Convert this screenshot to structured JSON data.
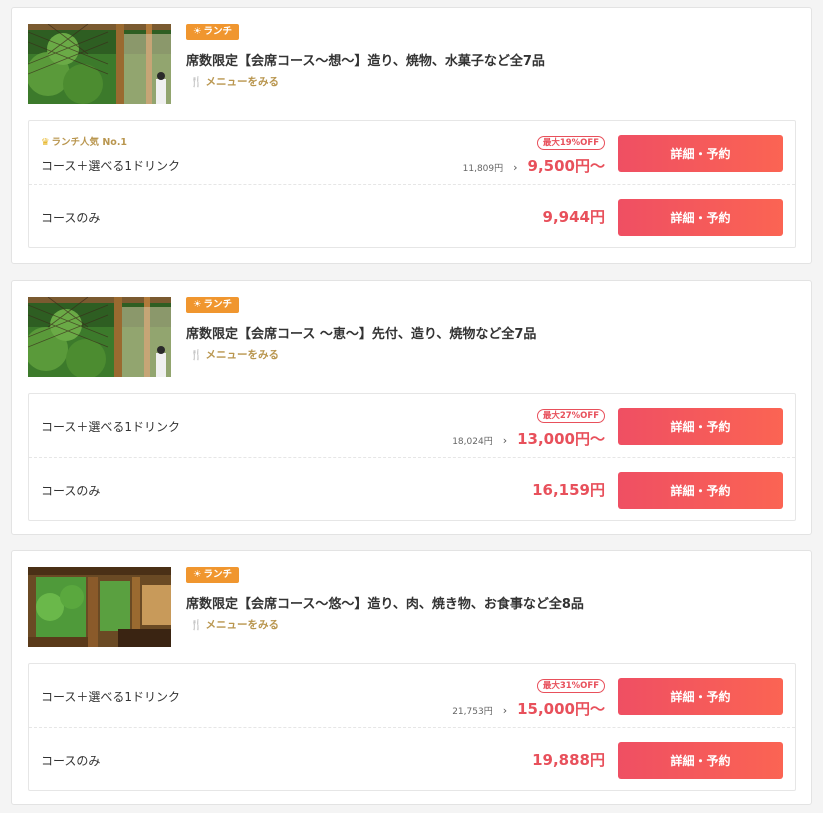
{
  "courses": [
    {
      "tag": "ランチ",
      "title": "席数限定【会席コース〜想〜】造り、焼物、水菓子など全7品",
      "menu_link": "メニューをみる",
      "plans": [
        {
          "rank_label": "ランチ人気 No.1",
          "name": "コース＋選べる1ドリンク",
          "discount": "最大19%OFF",
          "original_price": "11,809円",
          "price": "9,500円〜",
          "button": "詳細・予約"
        },
        {
          "name": "コースのみ",
          "price": "9,944円",
          "button": "詳細・予約"
        }
      ]
    },
    {
      "tag": "ランチ",
      "title": "席数限定【会席コース 〜恵〜】先付、造り、焼物など全7品",
      "menu_link": "メニューをみる",
      "plans": [
        {
          "name": "コース＋選べる1ドリンク",
          "discount": "最大27%OFF",
          "original_price": "18,024円",
          "price": "13,000円〜",
          "button": "詳細・予約"
        },
        {
          "name": "コースのみ",
          "price": "16,159円",
          "button": "詳細・予約"
        }
      ]
    },
    {
      "tag": "ランチ",
      "title": "席数限定【会席コース〜悠〜】造り、肉、焼き物、お食事など全8品",
      "menu_link": "メニューをみる",
      "plans": [
        {
          "name": "コース＋選べる1ドリンク",
          "discount": "最大31%OFF",
          "original_price": "21,753円",
          "price": "15,000円〜",
          "button": "詳細・予約"
        },
        {
          "name": "コースのみ",
          "price": "19,888円",
          "button": "詳細・予約"
        }
      ]
    }
  ],
  "colors": {
    "tag_bg": "#f0962f",
    "price": "#e8505b",
    "button_start": "#ef4f63",
    "button_end": "#fb6453",
    "menu_link": "#b9964f"
  },
  "icons": {
    "tag": "sun-icon",
    "menu_link": "fork-knife-icon",
    "rank": "crown-icon",
    "price_arrow": "chevron-right-icon"
  }
}
